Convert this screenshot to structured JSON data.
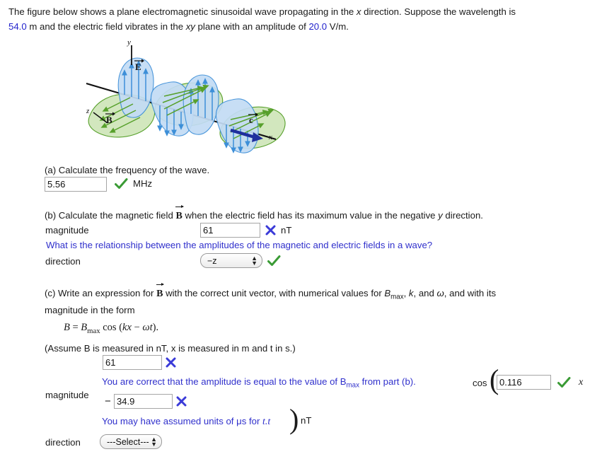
{
  "problem": {
    "line1_a": "The figure below shows a plane electromagnetic sinusoidal wave propagating in the ",
    "line1_x": "x",
    "line1_b": " direction. Suppose the wavelength is",
    "line2_val": "54.0",
    "line2_a": " m and the electric field vibrates in the ",
    "line2_xy": "xy",
    "line2_b": " plane with an amplitude of ",
    "line2_val2": "20.0",
    "line2_c": " V/m."
  },
  "figure": {
    "axis_y": "y",
    "axis_z": "z",
    "axis_x": "x",
    "label_E": "E",
    "label_B": "B",
    "label_c": "c",
    "colors": {
      "e_fill": "#c3dcf5",
      "e_stroke": "#3d8fd8",
      "b_fill": "#d2e7be",
      "b_stroke": "#57a02b",
      "axis": "#111111",
      "c_arrow": "#1f2f9e"
    }
  },
  "part_a": {
    "text": "(a) Calculate the frequency of the wave.",
    "answer": "5.56",
    "unit": "MHz",
    "mark": "correct"
  },
  "part_b": {
    "text_pre": "(b) Calculate the magnetic field ",
    "vector": "B",
    "text_post_a": " when the electric field has its maximum value in the negative ",
    "text_post_x": "y",
    "text_post_b": " direction.",
    "magnitude_label": "magnitude",
    "magnitude_value": "61",
    "magnitude_unit": "nT",
    "magnitude_mark": "incorrect",
    "feedback": "What is the relationship between the amplitudes of the magnetic and electric fields in a wave?",
    "direction_label": "direction",
    "direction_value": "−z",
    "direction_mark": "correct"
  },
  "part_c": {
    "text_pre": "(c) Write an expression for ",
    "vector": "B",
    "text_mid": " with the correct unit vector, with numerical values for ",
    "bmax": "B",
    "bmax_sub": "max",
    "text_mid2": ", ",
    "k": "k",
    "text_mid3": ", and ",
    "omega": "ω",
    "text_mid4": ", and with its",
    "text_line2": "magnitude in the form",
    "formula_b": "B",
    "formula_eq": " = ",
    "formula_bmax": "B",
    "formula_bmax_sub": "max",
    "formula_cos": " cos (",
    "formula_kx": "kx",
    "formula_minus": " − ",
    "formula_wt": "ωt",
    "formula_end": ").",
    "assume": "(Assume B is measured in nT, x is measured in m and t in s.)",
    "amplitude_value": "61",
    "amplitude_mark": "incorrect",
    "feedback_amp_pre": "You are correct that the amplitude is equal to the value of B",
    "feedback_amp_sub": "max",
    "feedback_amp_post": " from part (b).",
    "cos_label": "cos",
    "k_value": "0.116",
    "k_mark": "correct",
    "k_var": "x",
    "magnitude_label": "magnitude",
    "minus_sign": "−",
    "omega_value": "34.9",
    "omega_mark": "incorrect",
    "feedback_omega_pre": "You may have assumed units of μs for ",
    "feedback_omega_t": "t.t",
    "feedback_unit": "nT",
    "direction_label": "direction",
    "direction_value": "---Select---"
  }
}
